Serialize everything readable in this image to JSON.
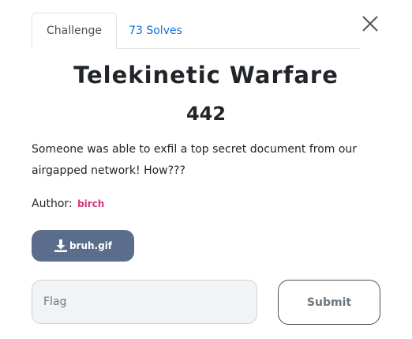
{
  "tabs": {
    "challenge_label": "Challenge",
    "solves_label": "73 Solves"
  },
  "challenge": {
    "title": "Telekinetic Warfare",
    "points": "442",
    "description": "Someone was able to exfil a top secret document from our airgapped network! How???",
    "author_label": "Author:",
    "author_name": "birch"
  },
  "file": {
    "label": "bruh.gif"
  },
  "flag": {
    "placeholder": "Flag"
  },
  "submit": {
    "label": "Submit"
  },
  "icons": {
    "close": "close-icon",
    "download": "download-icon"
  },
  "colors": {
    "tab_link": "#1070d8",
    "author": "#d6337d",
    "file_button": "#5a6e8c"
  }
}
